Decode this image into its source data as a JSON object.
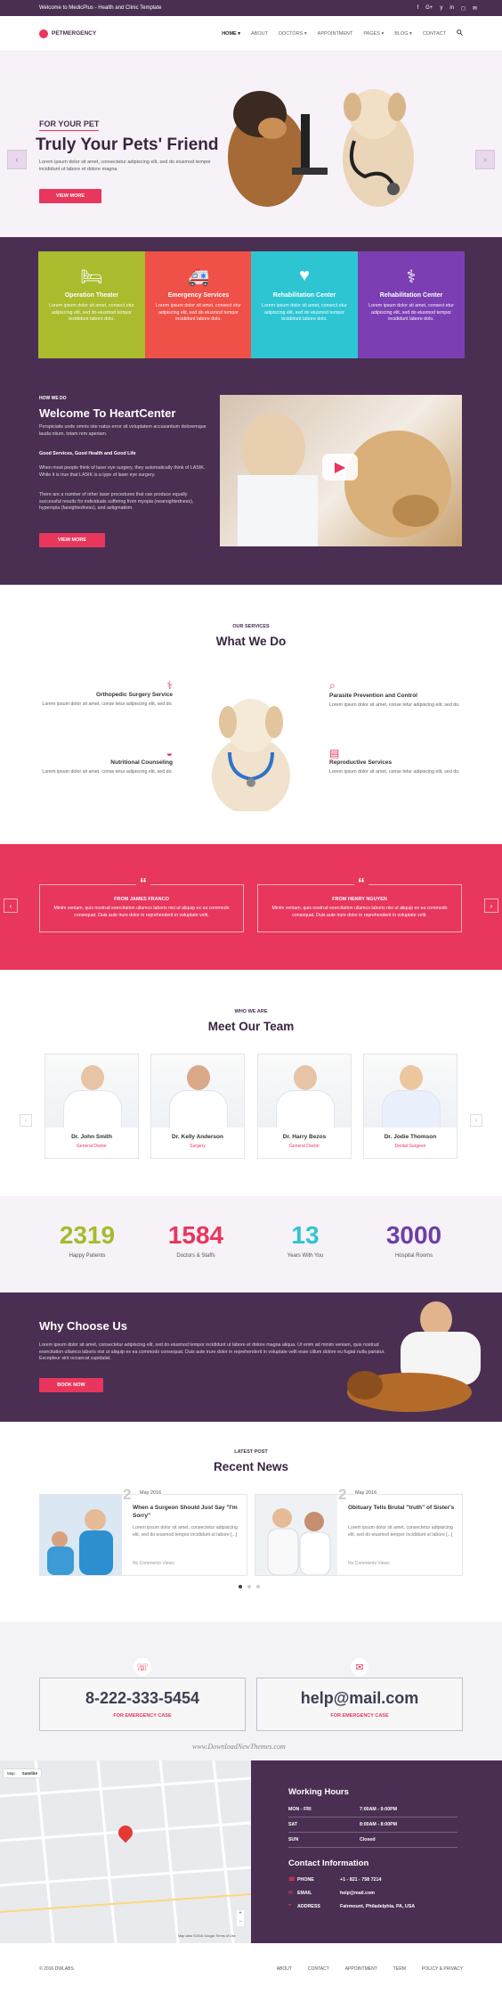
{
  "topbar": {
    "text": "Welcome to MedicPlus - Health and Clinic Template",
    "social": [
      "f",
      "G+",
      "y",
      "in",
      "◻",
      "✉"
    ]
  },
  "nav": {
    "logo": "PETMERGENCY",
    "items": [
      "HOME ▾",
      "ABOUT",
      "DOCTORS ▾",
      "APPOINTMENT",
      "PAGES ▾",
      "BLOG ▾",
      "CONTACT"
    ],
    "search_icon": "search-icon"
  },
  "hero": {
    "subtitle": "FOR YOUR PET",
    "title": "Truly Your Pets' Friend",
    "text": "Lorem ipsum dolor sit amet, consectetur adipiscing elit, sed do eiusmod tempor incididunt ut labore et dolore magna",
    "button": "VIEW MORE",
    "prev": "‹",
    "next": "›"
  },
  "services": [
    {
      "title": "Operation Theater",
      "icon": "bed-icon",
      "text": "Lorem ipsum dolor sit amet, consect etur adipiscing elit, sed do eiusmod tempor incididunt labore dolo.",
      "color": "#aabb2e"
    },
    {
      "title": "Emergency Services",
      "icon": "ambulance-icon",
      "text": "Lorem ipsum dolor sit amet, consect etur adipiscing elit, sed do eiusmod tempor incididunt labore dolo.",
      "color": "#ef5048"
    },
    {
      "title": "Rehabilitation Center",
      "icon": "heartbeat-icon",
      "text": "Lorem ipsum dolor sit amet, consect etur adipiscing elit, sed do eiusmod tempor incididunt labore dolo.",
      "color": "#2ec5d3"
    },
    {
      "title": "Rehabilitation Center",
      "icon": "nurse-icon",
      "text": "Lorem ipsum dolor sit amet, consect etur adipiscing elit, sed do eiusmod tempor incididunt labore dolo.",
      "color": "#7b3fb3"
    }
  ],
  "welcome": {
    "eyebrow": "HOW WE DO",
    "title": "Welcome To HeartCenter",
    "p1": "Perspiciatis unde omnis iste natus error sit voluptatem accusantium doloremque lauda ntium, totam rem aperiam.",
    "p2": "Good Services, Good Health and Good Life",
    "p3": "When most people think of laser eye surgery, they automatically think of LASIK. While it is true that LASIK is a type of laser eye surgery.",
    "p4": "There are a number of other laser procedures that can produce equally successful results for individuals suffering from myopia (nearsightedness), hyperopia (farsightedness), and astigmatism.",
    "button": "VIEW MORE",
    "play": "▶"
  },
  "services_section": {
    "eyebrow": "OUR SERVICES",
    "title": "What We Do",
    "left": [
      {
        "title": "Orthopedic Surgery Service",
        "text": "Lorem ipsum dolor sit amet, conse tetur adipiscing elit, sed do.",
        "icon": "bone-icon"
      },
      {
        "title": "Nutritional Counseling",
        "text": "Lorem ipsum dolor sit amet, conse tetur adipiscing elit, sed do.",
        "icon": "bowl-icon"
      }
    ],
    "right": [
      {
        "title": "Parasite Prevention and Control",
        "text": "Lorem ipsum dolor sit amet, conse tetur adipiscing elit, sed do.",
        "icon": "microscope-icon"
      },
      {
        "title": "Reproductive Services",
        "text": "Lorem ipsum dolor sit amet, conse tetur adipiscing elit, sed do.",
        "icon": "clipboard-icon"
      }
    ]
  },
  "testimonials": [
    {
      "name": "FROM JAMES FRANCO",
      "text": "Minim veniam, quis nostrud exercitation ullamco laboris nisi ut aliquip ex ea commodo consequat. Duis aute irure dolor in reprehenderit in voluptate velit."
    },
    {
      "name": "FROM HENRY NGUYEN",
      "text": "Minim veniam, quis nostrud exercitation ullamco laboris nisi ut aliquip ex ea commodo consequat. Duis aute irure dolor in reprehenderit in voluptate velit."
    }
  ],
  "team": {
    "eyebrow": "WHO WE ARE",
    "title": "Meet Our Team",
    "members": [
      {
        "name": "Dr. John Smith",
        "role": "General Doctor"
      },
      {
        "name": "Dr. Kelly Anderson",
        "role": "Surgery"
      },
      {
        "name": "Dr. Harry Bezos",
        "role": "General Doctor"
      },
      {
        "name": "Dr. Jodie Thomson",
        "role": "Dental Surgeon"
      }
    ]
  },
  "stats": [
    {
      "value": "2319",
      "label": "Happy Patients",
      "color": "#a5bb2d"
    },
    {
      "value": "1584",
      "label": "Doctors & Staffs",
      "color": "#e8365d"
    },
    {
      "value": "13",
      "label": "Years With You",
      "color": "#2ec5d3"
    },
    {
      "value": "3000",
      "label": "Hospital Rooms",
      "color": "#6b3fa6"
    }
  ],
  "why": {
    "title": "Why Choose Us",
    "text": "Lorem ipsum dolor sit amet, consectetur adipiscing elit, sed do eiusmod tempor incididunt ut labore et dolore magna aliqua. Ut enim ad minim veniam, quis nostrud exercitation ullamco laboris nisi ut aliquip ex ea commodo consequat. Duis aute irure dolor in reprehenderit in voluptate velit esse cillum dolore eu fugiat nulla pariatur. Excepteur sint occaecat cupidatat.",
    "button": "BOOK NOW"
  },
  "news": {
    "eyebrow": "LATEST POST",
    "title": "Recent News",
    "posts": [
      {
        "day": "2",
        "month": "May 2016",
        "title": "When a Surgeon Should Just Say \"I'm Sorry\"",
        "text": "Lorem ipsum dolor sit amet, consectetur adipisicing elit, sed do eiusmod tempor incididunt ut labore [...]",
        "meta": "No Comments   Views"
      },
      {
        "day": "2",
        "month": "May 2016",
        "title": "Obituary Tells Brutal \"truth\" of Sister's",
        "text": "Lorem ipsum dolor sit amet, consectetur adipisicing elit, sed do eiusmod tempor incididunt ut labore [...]",
        "meta": "No Comments   Views"
      }
    ]
  },
  "contact": {
    "phone": "8-222-333-5454",
    "phone_label": "FOR EMERGENCY CASE",
    "email": "help@mail.com",
    "email_label": "FOR EMERGENCY CASE",
    "watermark": "www.DownloadNewThemes.com"
  },
  "map": {
    "tab1": "Map",
    "tab2": "Satellite",
    "zoom_in": "+",
    "zoom_out": "−",
    "note": "Map data ©2016 Google   Terms of Use"
  },
  "hours": {
    "title": "Working Hours",
    "rows": [
      {
        "day": "MON - FRI",
        "time": "7:00AM - 9:00PM"
      },
      {
        "day": "SAT",
        "time": "8:00AM - 8:00PM"
      },
      {
        "day": "SUN",
        "time": "Closed"
      }
    ],
    "contact_title": "Contact Information",
    "contact": [
      {
        "icon": "phone-icon",
        "glyph": "☎",
        "label": "PHONE",
        "value": "+1 - 821 - 758 7214"
      },
      {
        "icon": "email-icon",
        "glyph": "✉",
        "label": "EMAIL",
        "value": "help@mail.com"
      },
      {
        "icon": "location-icon",
        "glyph": "⌖",
        "label": "ADDRESS",
        "value": "Fairmount, Philadelphia, PA, USA"
      }
    ]
  },
  "footer": {
    "copy": "© 2016 DWLABS",
    "links": [
      "ABOUT",
      "CONTACT",
      "APPOINTMENT",
      "TERM",
      "POLICY & PRIVACY"
    ]
  }
}
